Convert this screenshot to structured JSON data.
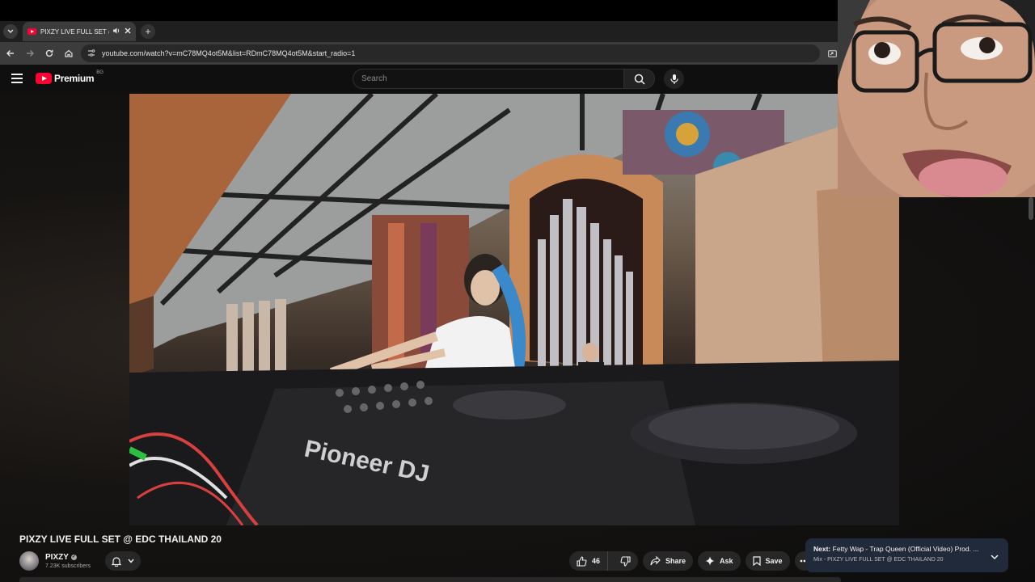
{
  "browser": {
    "tab": {
      "title": "PIXZY LIVE FULL SET @ EDC",
      "audio_icon": "speaker-icon",
      "close_icon": "close-icon"
    },
    "new_tab_label": "+",
    "url": "youtube.com/watch?v=mC78MQ4ot5M&list=RDmC78MQ4ot5M&start_radio=1"
  },
  "youtube": {
    "logo_text": "Premium",
    "region": "BG",
    "search_placeholder": "Search"
  },
  "video": {
    "title": "PIXZY LIVE FULL SET @ EDC THAILAND 20",
    "overlay_brand": "Pioneer DJ",
    "channel_name": "PIXZY",
    "subscribers": "7.23K subscribers",
    "likes": "46",
    "share_label": "Share",
    "ask_label": "Ask",
    "save_label": "Save"
  },
  "up_next": {
    "prefix": "Next:",
    "title": "Fetty Wap - Trap Queen (Official Video) Prod. ...",
    "subtitle": "Mix - PIXZY LIVE FULL SET @ EDC THAILAND 20"
  },
  "colors": {
    "brand_red": "#ff0033",
    "background": "#0f0f0f",
    "pill": "#272727",
    "next_card": "#212a3a"
  }
}
